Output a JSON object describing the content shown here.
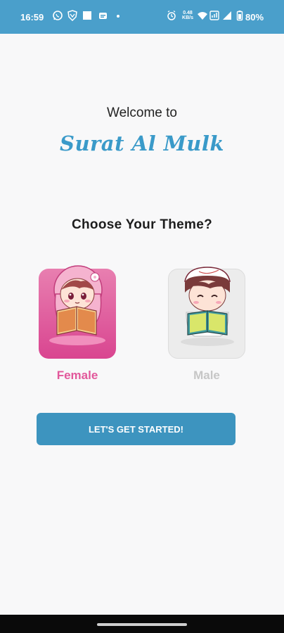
{
  "status_bar": {
    "time": "16:59",
    "net_speed_value": "0.48",
    "net_speed_unit": "KB/s",
    "battery": "80%",
    "icons": [
      "whatsapp-icon",
      "vpn-shield-icon",
      "square-notification-icon",
      "message-icon",
      "dot-icon",
      "alarm-icon",
      "wifi-icon",
      "signal-icon",
      "battery-icon"
    ]
  },
  "welcome": {
    "line1": "Welcome to",
    "app_name": "Surat Al Mulk"
  },
  "theme_picker": {
    "question": "Choose Your Theme?",
    "options": [
      {
        "label": "Female",
        "selected": true,
        "color": "#e2589b"
      },
      {
        "label": "Male",
        "selected": false,
        "color": "#c6c6c6"
      }
    ]
  },
  "start_button": {
    "label": "LET'S GET STARTED!"
  },
  "colors": {
    "status_bar": "#4a9fcb",
    "accent_blue": "#3a9ac9",
    "button": "#3d94bf",
    "female_pink": "#e2589b"
  }
}
